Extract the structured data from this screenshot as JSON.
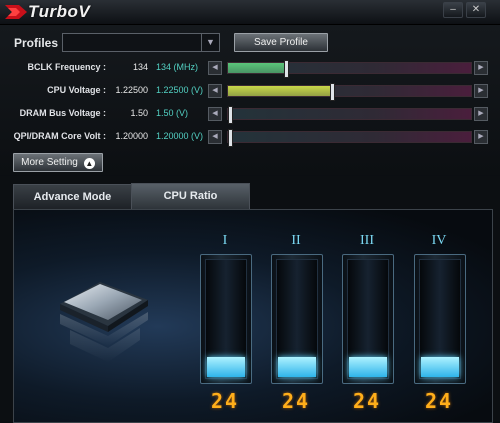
{
  "app": {
    "title": "TurboV"
  },
  "window": {
    "minimize_glyph": "–",
    "close_glyph": "✕"
  },
  "profiles": {
    "label": "Profiles :",
    "value": "",
    "save_label": "Save Profile"
  },
  "rows": [
    {
      "label": "BCLK Frequency :",
      "value": "134",
      "unit_value": "134 (MHz)",
      "fraction": 0.24,
      "fill_color": "#5bc57a"
    },
    {
      "label": "CPU Voltage :",
      "value": "1.22500",
      "unit_value": "1.22500 (V)",
      "fraction": 0.43,
      "fill_color": "#c9d84a"
    },
    {
      "label": "DRAM Bus Voltage :",
      "value": "1.50",
      "unit_value": "1.50 (V)",
      "fraction": 0.0,
      "fill_color": "#3fb39a"
    },
    {
      "label": "QPI/DRAM Core Volt :",
      "value": "1.20000",
      "unit_value": "1.20000 (V)",
      "fraction": 0.0,
      "fill_color": "#3fb39a"
    }
  ],
  "more_setting": {
    "label": "More Setting"
  },
  "tabs": [
    {
      "label": "Advance Mode",
      "active": false
    },
    {
      "label": "CPU Ratio",
      "active": true
    }
  ],
  "cpu_ratio": {
    "columns": [
      {
        "label": "I",
        "value": "24"
      },
      {
        "label": "II",
        "value": "24"
      },
      {
        "label": "III",
        "value": "24"
      },
      {
        "label": "IV",
        "value": "24"
      }
    ]
  },
  "colors": {
    "accent": "#53d1c3",
    "digits": "#ffae1a",
    "brand_red": "#c8101a"
  }
}
